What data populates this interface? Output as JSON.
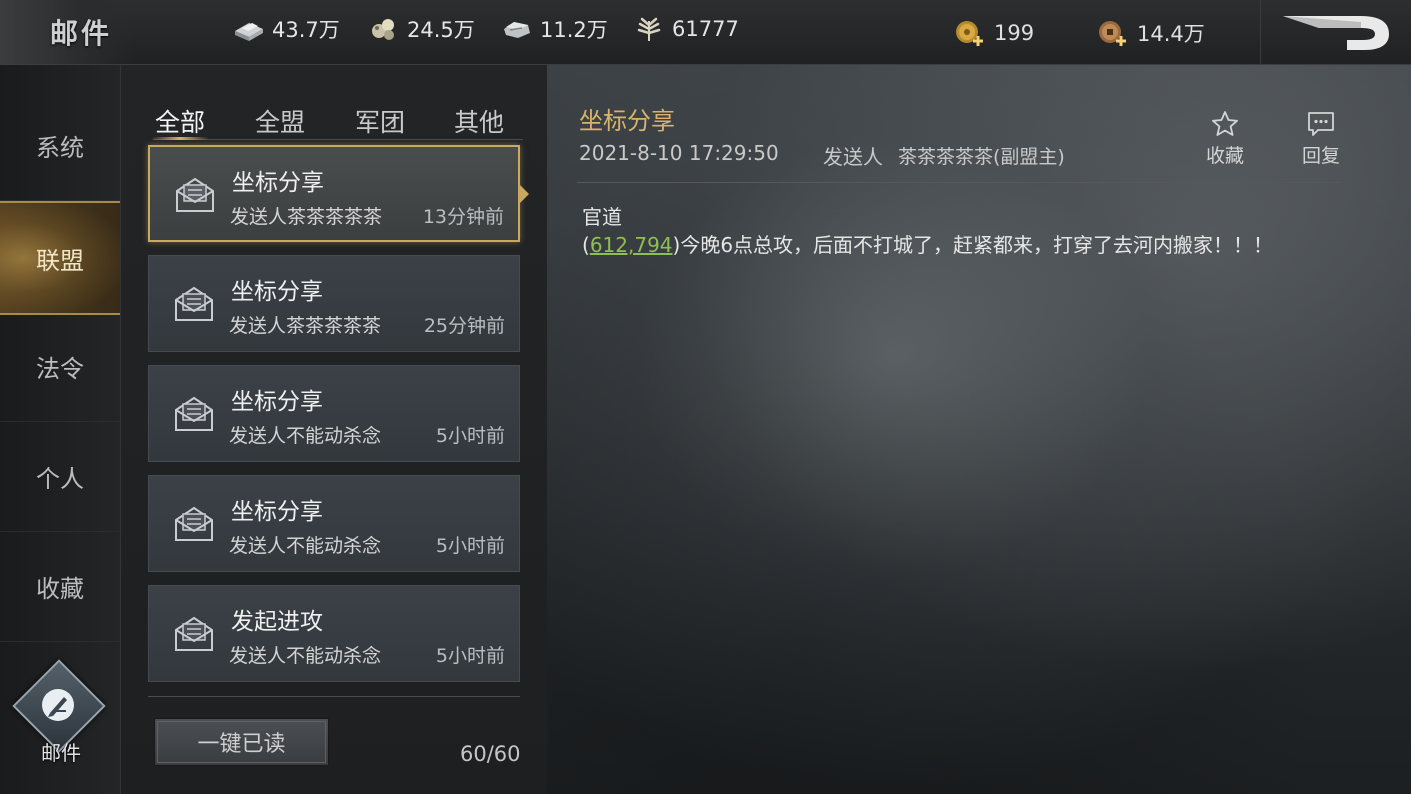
{
  "header": {
    "title": "邮件",
    "resources": [
      {
        "icon": "silver-ingot-icon",
        "value": "43.7万"
      },
      {
        "icon": "ore-icon",
        "value": "24.5万"
      },
      {
        "icon": "stone-icon",
        "value": "11.2万"
      },
      {
        "icon": "grain-icon",
        "value": "61777"
      }
    ],
    "currencies": [
      {
        "icon": "gold-coin-add-icon",
        "value": "199"
      },
      {
        "icon": "copper-coin-add-icon",
        "value": "14.4万"
      }
    ]
  },
  "sidebar": {
    "items": [
      {
        "label": "系统"
      },
      {
        "label": "联盟"
      },
      {
        "label": "法令"
      },
      {
        "label": "个人"
      },
      {
        "label": "收藏"
      }
    ],
    "active_index": 1,
    "compose_label": "邮件"
  },
  "tabs": [
    {
      "label": "全部"
    },
    {
      "label": "全盟"
    },
    {
      "label": "军团"
    },
    {
      "label": "其他"
    }
  ],
  "active_tab": 0,
  "mails": [
    {
      "subject": "坐标分享",
      "sender": "发送人茶茶茶茶茶",
      "time": "13分钟前"
    },
    {
      "subject": "坐标分享",
      "sender": "发送人茶茶茶茶茶",
      "time": "25分钟前"
    },
    {
      "subject": "坐标分享",
      "sender": "发送人不能动杀念",
      "time": "5小时前"
    },
    {
      "subject": "坐标分享",
      "sender": "发送人不能动杀念",
      "time": "5小时前"
    },
    {
      "subject": "发起进攻",
      "sender": "发送人不能动杀念",
      "time": "5小时前"
    }
  ],
  "list_footer": {
    "read_all_label": "一键已读",
    "count": "60/60"
  },
  "detail": {
    "subject": "坐标分享",
    "date": "2021-8-10 17:29:50",
    "sender_label": "发送人",
    "sender": "茶茶茶茶茶(副盟主)",
    "favorite_label": "收藏",
    "reply_label": "回复",
    "body_line1": "官道",
    "body_open": "(",
    "coords": "612,794",
    "body_rest": ")今晚6点总攻，后面不打城了，赶紧都来，打穿了去河内搬家！！！"
  },
  "colors": {
    "accent_gold": "#d9b36c",
    "link_green": "#8fbf4f",
    "selected_border": "#c9a862"
  }
}
